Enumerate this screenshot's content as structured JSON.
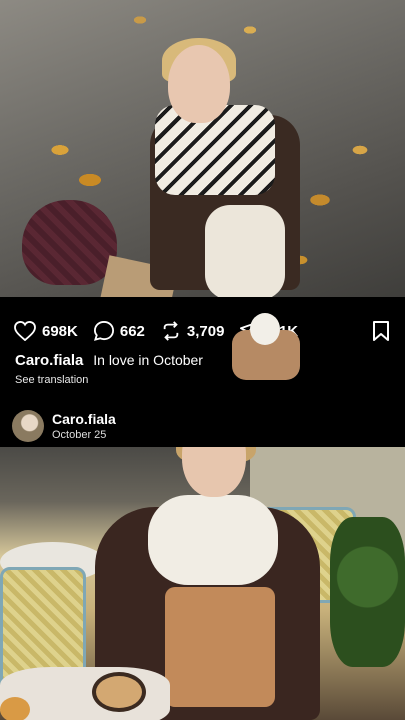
{
  "post": {
    "likes": "698K",
    "comments": "662",
    "reposts": "3,709",
    "shares": "1.1K",
    "username": "Caro.fiala",
    "caption_text": "In love in October",
    "see_translation": "See translation"
  },
  "next_post": {
    "username": "Caro.fiala",
    "date": "October 25"
  },
  "icons": {
    "like": "heart-icon",
    "comment": "speech-bubble-icon",
    "repost": "repost-icon",
    "share": "paper-plane-icon",
    "save": "bookmark-icon"
  }
}
